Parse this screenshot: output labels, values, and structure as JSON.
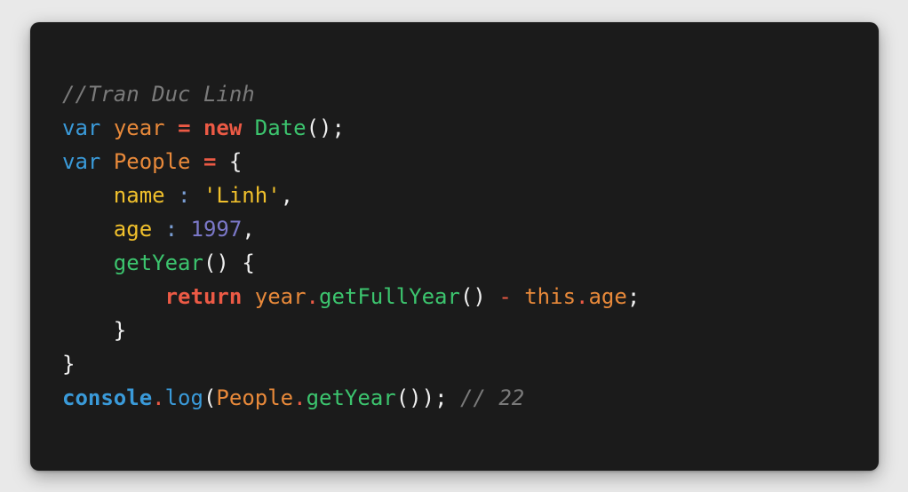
{
  "colors": {
    "background": "#e9e9e9",
    "panel": "#1b1b1b",
    "comment": "#7a7a7a",
    "keyword_blue": "#3a9ad9",
    "keyword_red": "#ec5a45",
    "variable_orange": "#e8893a",
    "class_green": "#3cc46e",
    "property_yellow": "#f0c02c",
    "string_yellow": "#f0c02c",
    "number_purple": "#7b78c8",
    "punctuation": "#f0f0f0",
    "operator_blue": "#7a9ed4"
  },
  "code": {
    "language": "javascript",
    "lines": [
      {
        "indent": "",
        "tokens": [
          {
            "text": "//Tran Duc Linh",
            "role": "comment",
            "color": "#7a7a7a",
            "italic": true
          }
        ]
      },
      {
        "indent": "",
        "tokens": [
          {
            "text": "var",
            "role": "keyword",
            "color": "#3a9ad9"
          },
          {
            "text": " ",
            "role": "space",
            "color": "#f0f0f0"
          },
          {
            "text": "year",
            "role": "variable",
            "color": "#e8893a"
          },
          {
            "text": " ",
            "role": "space",
            "color": "#f0f0f0"
          },
          {
            "text": "=",
            "role": "operator",
            "color": "#ec5a45",
            "bold": true
          },
          {
            "text": " ",
            "role": "space",
            "color": "#f0f0f0"
          },
          {
            "text": "new",
            "role": "keyword",
            "color": "#ec5a45",
            "bold": true
          },
          {
            "text": " ",
            "role": "space",
            "color": "#f0f0f0"
          },
          {
            "text": "Date",
            "role": "class",
            "color": "#3cc46e"
          },
          {
            "text": "();",
            "role": "punctuation",
            "color": "#f0f0f0"
          }
        ]
      },
      {
        "indent": "",
        "tokens": [
          {
            "text": "var",
            "role": "keyword",
            "color": "#3a9ad9"
          },
          {
            "text": " ",
            "role": "space",
            "color": "#f0f0f0"
          },
          {
            "text": "People",
            "role": "variable",
            "color": "#e8893a"
          },
          {
            "text": " ",
            "role": "space",
            "color": "#f0f0f0"
          },
          {
            "text": "=",
            "role": "operator",
            "color": "#ec5a45",
            "bold": true
          },
          {
            "text": " ",
            "role": "space",
            "color": "#f0f0f0"
          },
          {
            "text": "{",
            "role": "punctuation",
            "color": "#f0f0f0"
          }
        ]
      },
      {
        "indent": "    ",
        "tokens": [
          {
            "text": "name",
            "role": "property",
            "color": "#f0c02c"
          },
          {
            "text": " ",
            "role": "space",
            "color": "#f0f0f0"
          },
          {
            "text": ":",
            "role": "operator",
            "color": "#7a9ed4"
          },
          {
            "text": " ",
            "role": "space",
            "color": "#f0f0f0"
          },
          {
            "text": "'Linh'",
            "role": "string",
            "color": "#f0c02c"
          },
          {
            "text": ",",
            "role": "punctuation",
            "color": "#f0f0f0"
          }
        ]
      },
      {
        "indent": "    ",
        "tokens": [
          {
            "text": "age",
            "role": "property",
            "color": "#f0c02c"
          },
          {
            "text": " ",
            "role": "space",
            "color": "#f0f0f0"
          },
          {
            "text": ":",
            "role": "operator",
            "color": "#7a9ed4"
          },
          {
            "text": " ",
            "role": "space",
            "color": "#f0f0f0"
          },
          {
            "text": "1997",
            "role": "number",
            "color": "#7b78c8"
          },
          {
            "text": ",",
            "role": "punctuation",
            "color": "#f0f0f0"
          }
        ]
      },
      {
        "indent": "    ",
        "tokens": [
          {
            "text": "getYear",
            "role": "method",
            "color": "#3cc46e"
          },
          {
            "text": "()",
            "role": "punctuation",
            "color": "#f0f0f0"
          },
          {
            "text": " ",
            "role": "space",
            "color": "#f0f0f0"
          },
          {
            "text": "{",
            "role": "punctuation",
            "color": "#f0f0f0"
          }
        ]
      },
      {
        "indent": "        ",
        "tokens": [
          {
            "text": "return",
            "role": "keyword",
            "color": "#ec5a45",
            "bold": true
          },
          {
            "text": " ",
            "role": "space",
            "color": "#f0f0f0"
          },
          {
            "text": "year",
            "role": "variable",
            "color": "#e8893a"
          },
          {
            "text": ".",
            "role": "accessor",
            "color": "#ec5a45"
          },
          {
            "text": "getFullYear",
            "role": "method",
            "color": "#3cc46e"
          },
          {
            "text": "()",
            "role": "punctuation",
            "color": "#f0f0f0"
          },
          {
            "text": " ",
            "role": "space",
            "color": "#f0f0f0"
          },
          {
            "text": "-",
            "role": "operator",
            "color": "#ec5a45"
          },
          {
            "text": " ",
            "role": "space",
            "color": "#f0f0f0"
          },
          {
            "text": "this",
            "role": "keyword",
            "color": "#e8893a"
          },
          {
            "text": ".",
            "role": "accessor",
            "color": "#ec5a45"
          },
          {
            "text": "age",
            "role": "property",
            "color": "#e8893a"
          },
          {
            "text": ";",
            "role": "punctuation",
            "color": "#f0f0f0"
          }
        ]
      },
      {
        "indent": "    ",
        "tokens": [
          {
            "text": "}",
            "role": "punctuation",
            "color": "#f0f0f0"
          }
        ]
      },
      {
        "indent": "",
        "tokens": [
          {
            "text": "}",
            "role": "punctuation",
            "color": "#f0f0f0"
          }
        ]
      },
      {
        "indent": "",
        "tokens": [
          {
            "text": "console",
            "role": "builtin",
            "color": "#3a9ad9",
            "bold": true
          },
          {
            "text": ".",
            "role": "accessor",
            "color": "#ec5a45"
          },
          {
            "text": "log",
            "role": "method",
            "color": "#3a9ad9"
          },
          {
            "text": "(",
            "role": "punctuation",
            "color": "#f0f0f0"
          },
          {
            "text": "People",
            "role": "variable",
            "color": "#e8893a"
          },
          {
            "text": ".",
            "role": "accessor",
            "color": "#ec5a45"
          },
          {
            "text": "getYear",
            "role": "method",
            "color": "#3cc46e"
          },
          {
            "text": "());",
            "role": "punctuation",
            "color": "#f0f0f0"
          },
          {
            "text": " ",
            "role": "space",
            "color": "#f0f0f0"
          },
          {
            "text": "// 22",
            "role": "comment",
            "color": "#7a7a7a",
            "italic": true
          }
        ]
      }
    ]
  }
}
